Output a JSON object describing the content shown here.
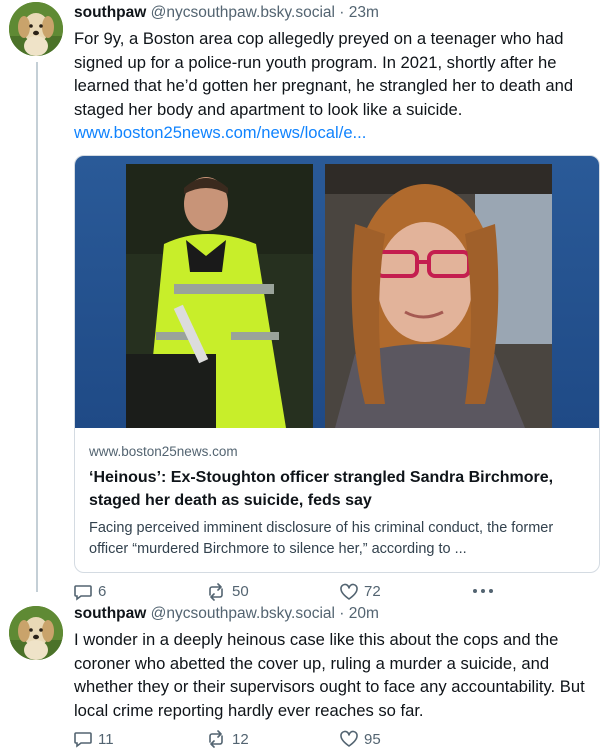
{
  "posts": [
    {
      "display_name": "southpaw",
      "handle": "@nycsouthpaw.bsky.social",
      "separator": "·",
      "time": "23m",
      "text": "For 9y, a Boston area cop allegedly preyed on a teenager who had signed up for a police-run youth program. In 2021, shortly after he learned that he’d gotten her pregnant, he strangled her to death and staged her body and apartment to look like a suicide.",
      "link_text": "www.boston25news.com/news/local/e...",
      "card": {
        "domain": "www.boston25news.com",
        "title": "‘Heinous’: Ex-Stoughton officer strangled Sandra Birchmore, staged her death as suicide, feds say",
        "description": "Facing perceived imminent disclosure of his criminal conduct, the former officer “murdered Birchmore to silence her,” according to ..."
      },
      "replies": "6",
      "reposts": "50",
      "likes": "72"
    },
    {
      "display_name": "southpaw",
      "handle": "@nycsouthpaw.bsky.social",
      "separator": "·",
      "time": "20m",
      "text": "I wonder in a deeply heinous case like this about the cops and the coroner who abetted the cover up, ruling a murder a suicide, and whether they or their supervisors ought to face any accountability. But local crime reporting hardly ever reaches so far.",
      "replies": "11",
      "reposts": "12",
      "likes": "95"
    }
  ],
  "icons": {
    "reply": "speech-bubble-icon",
    "repost": "repost-arrows-icon",
    "like": "heart-icon",
    "more": "ellipsis-icon"
  },
  "colors": {
    "link": "#1083fe",
    "muted": "#536471",
    "card_media_bg": "#2a5a98"
  }
}
